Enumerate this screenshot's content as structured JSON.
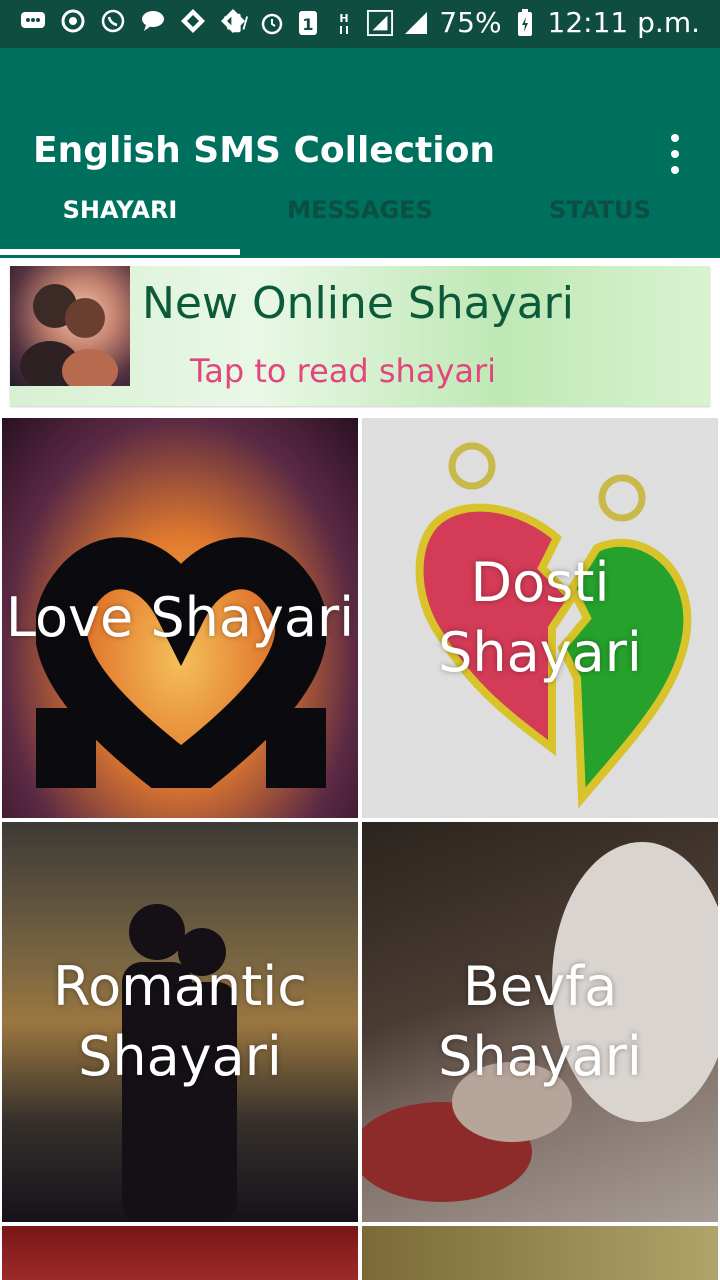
{
  "status_bar": {
    "battery_percent": "75%",
    "time": "12:11 p.m."
  },
  "app": {
    "title": "English SMS Collection"
  },
  "tabs": [
    {
      "label": "SHAYARI",
      "active": true
    },
    {
      "label": "MESSAGES",
      "active": false
    },
    {
      "label": "STATUS",
      "active": false
    }
  ],
  "banner": {
    "title": "New Online Shayari",
    "subtitle": "Tap to read shayari"
  },
  "tiles": [
    {
      "label": "Love Shayari"
    },
    {
      "label": "Dosti Shayari"
    },
    {
      "label": "Romantic Shayari",
      "lines": [
        "Romantic",
        "Shayari"
      ]
    },
    {
      "label": "Bevfa Shayari",
      "lines": [
        "Bevfa",
        "Shayari"
      ]
    }
  ],
  "colors": {
    "status_bar": "#0e4d3f",
    "app_bar": "#00705e",
    "banner_title": "#0b5a39",
    "banner_subtitle": "#e3467e"
  },
  "icons": {
    "status_left": [
      "chat-icon",
      "sync-icon",
      "whatsapp-icon",
      "message-icon",
      "diamond-icon",
      "diamond-icon"
    ],
    "status_right": [
      "vibrate-icon",
      "alarm-icon",
      "sim-icon",
      "network-h-icon",
      "signal-icon",
      "signal-icon",
      "battery-icon"
    ],
    "app_bar": [
      "overflow-menu-icon"
    ]
  }
}
